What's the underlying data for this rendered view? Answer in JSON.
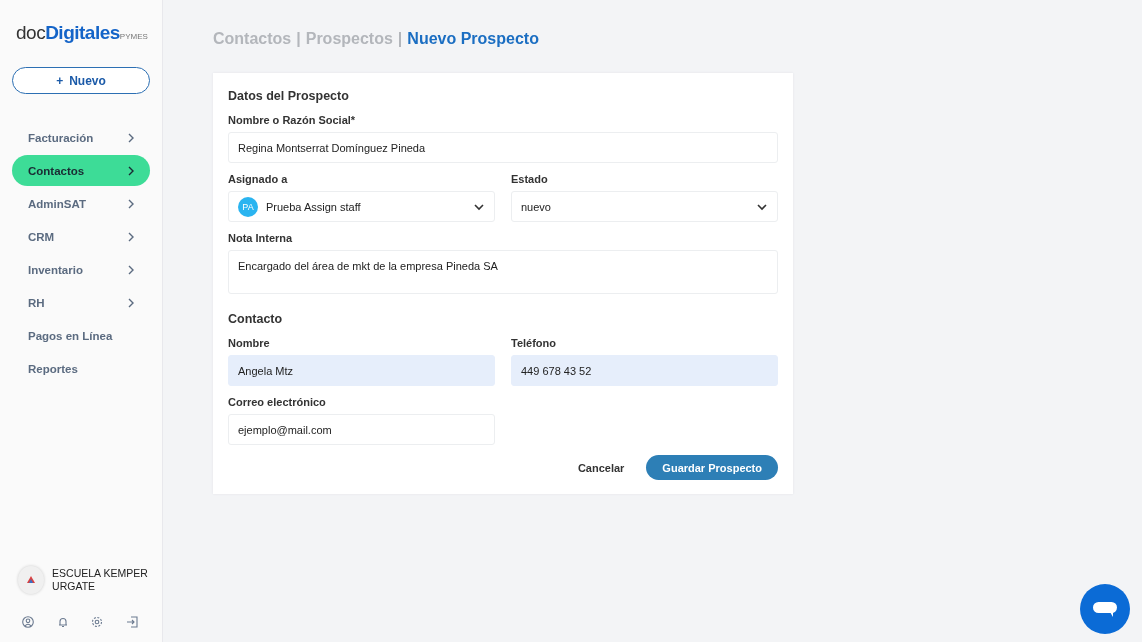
{
  "sidebar": {
    "logo": {
      "prefix": "doc",
      "brand": "Digitales",
      "suffix": "PYMES"
    },
    "new_button": {
      "icon": "+",
      "label": "Nuevo"
    },
    "items": [
      {
        "label": "Facturación",
        "expandable": true,
        "selected": false
      },
      {
        "label": "Contactos",
        "expandable": true,
        "selected": true
      },
      {
        "label": "AdminSAT",
        "expandable": true,
        "selected": false
      },
      {
        "label": "CRM",
        "expandable": true,
        "selected": false
      },
      {
        "label": "Inventario",
        "expandable": true,
        "selected": false
      },
      {
        "label": "RH",
        "expandable": true,
        "selected": false
      },
      {
        "label": "Pagos en Línea",
        "expandable": false,
        "selected": false
      },
      {
        "label": "Reportes",
        "expandable": false,
        "selected": false
      }
    ],
    "organization": {
      "name": "ESCUELA KEMPER URGATE"
    }
  },
  "breadcrumb": [
    {
      "label": "Contactos",
      "current": false
    },
    {
      "label": "Prospectos",
      "current": false
    },
    {
      "label": "Nuevo Prospecto",
      "current": true
    }
  ],
  "breadcrumb_separator": "|",
  "form": {
    "sections": [
      {
        "title": "Datos del Prospecto",
        "rows": [
          [
            {
              "kind": "text",
              "label": "Nombre o Razón Social*",
              "value": "Regina Montserrat Domínguez Pineda",
              "highlighted": false
            }
          ],
          [
            {
              "kind": "select",
              "label": "Asignado a",
              "avatar": "PA",
              "value": "Prueba Assign staff",
              "highlighted": false
            },
            {
              "kind": "select",
              "label": "Estado",
              "value": "nuevo",
              "highlighted": false
            }
          ],
          [
            {
              "kind": "textarea",
              "label": "Nota Interna",
              "value": "Encargado del área de mkt de la empresa Pineda SA",
              "highlighted": false
            }
          ]
        ]
      },
      {
        "title": "Contacto",
        "rows": [
          [
            {
              "kind": "text",
              "label": "Nombre",
              "value": "Angela Mtz",
              "highlighted": true
            },
            {
              "kind": "text",
              "label": "Teléfono",
              "value": "449 678 43 52",
              "highlighted": true
            }
          ],
          [
            {
              "kind": "text",
              "label": "Correo electrónico",
              "value": "ejemplo@mail.com",
              "highlighted": false
            },
            {
              "kind": "empty"
            }
          ]
        ]
      }
    ],
    "cancel_button": "Cancelar",
    "save_button": "Guardar Prospecto"
  }
}
